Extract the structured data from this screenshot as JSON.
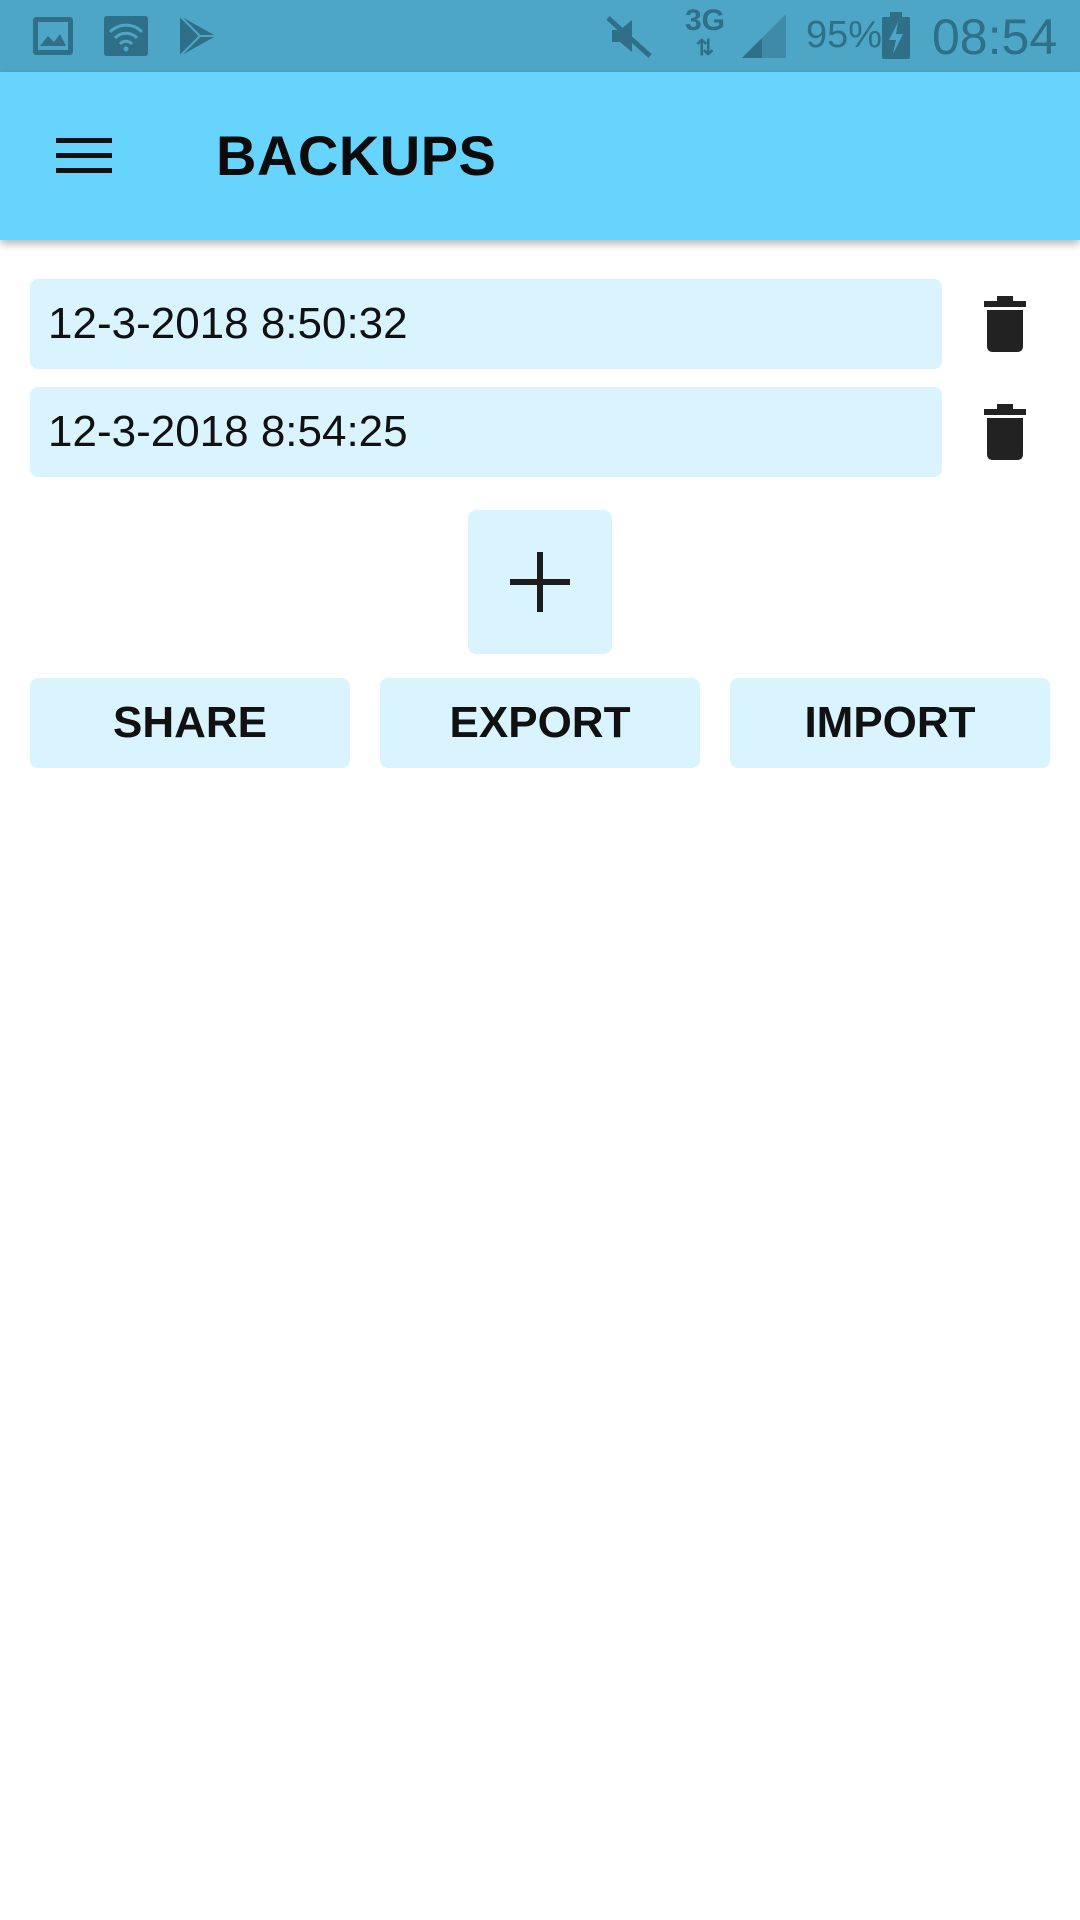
{
  "status_bar": {
    "battery": "95%",
    "time": "08:54",
    "network_type": "3G",
    "icons": [
      "gallery-icon",
      "wifi-icon",
      "play-store-icon",
      "mute-icon",
      "network-3g-icon",
      "signal-icon",
      "battery-charging-icon"
    ]
  },
  "app_bar": {
    "title": "BACKUPS",
    "menu_icon": "hamburger-menu-icon",
    "background_color": "#66d4fd"
  },
  "backups": [
    {
      "label": "12-3-2018 8:50:32",
      "delete_icon": "trash-icon"
    },
    {
      "label": "12-3-2018 8:54:25",
      "delete_icon": "trash-icon"
    }
  ],
  "add_button": {
    "icon": "plus-icon"
  },
  "actions": {
    "share": "SHARE",
    "export": "EXPORT",
    "import": "IMPORT"
  },
  "colors": {
    "accent": "#66d4fd",
    "field_background": "#d9f4fe",
    "status_bar": "#4ea6c7"
  }
}
